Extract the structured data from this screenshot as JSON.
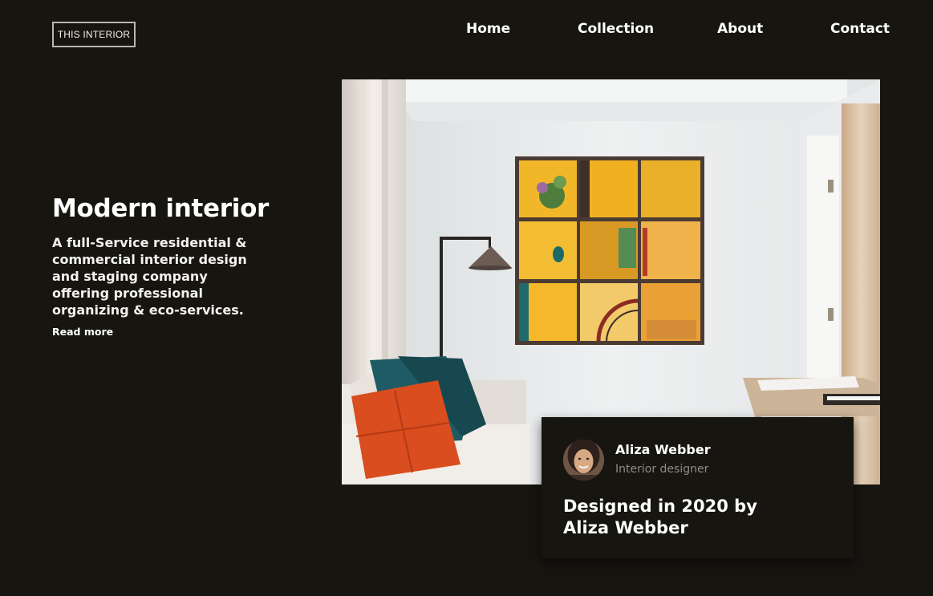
{
  "header": {
    "logo": "THIS INTERIOR",
    "nav": [
      "Home",
      "Collection",
      "About",
      "Contact"
    ]
  },
  "hero": {
    "title": "Modern interior",
    "description": "A full-Service residential & commercial interior design and staging company offering professional organizing & eco-services.",
    "read_more": "Read more"
  },
  "designer": {
    "name": "Aliza Webber",
    "role": "Interior designer",
    "caption": "Designed in 2020 by Aliza Webber"
  },
  "colors": {
    "background": "#171510",
    "text": "#ffffff",
    "muted": "#8e8c86",
    "artwork_yellow": "#f2b728",
    "pillow_orange": "#d94d1f",
    "pillow_teal": "#1f5b64"
  }
}
